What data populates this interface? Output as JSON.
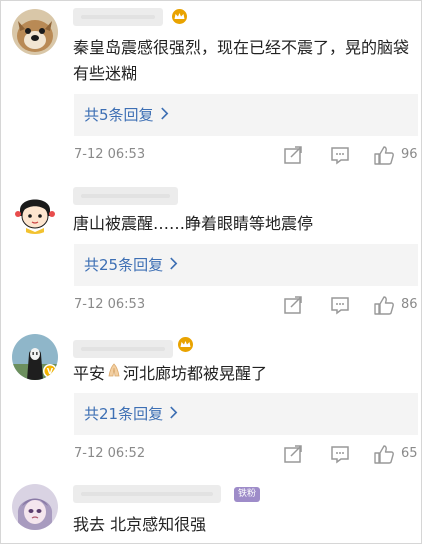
{
  "comments": [
    {
      "text": "秦皇岛震感很强烈，现在已经不震了，晃的脑袋有些迷糊",
      "reply_link": "共5条回复",
      "time": "7-12 06:53",
      "likes": "96"
    },
    {
      "text": "唐山被震醒……睁着眼睛等地震停",
      "reply_link": "共25条回复",
      "time": "7-12 06:53",
      "likes": "86"
    },
    {
      "text_before": "平安",
      "text_after": "河北廊坊都被晃醒了",
      "reply_link": "共21条回复",
      "time": "7-12 06:52",
      "likes": "65"
    },
    {
      "text": "我去 北京感知很强",
      "fan_badge": "铁粉"
    }
  ],
  "icons": {
    "reply_chevron": "chevron-right-icon",
    "share": "share-icon",
    "comment": "comment-icon",
    "like": "thumb-up-icon",
    "crown": "crown-badge-icon",
    "pray": "pray-emoji-icon"
  },
  "colors": {
    "link": "#3d6fb4",
    "meta": "#8a8a8a",
    "reply_bg": "#f4f4f4",
    "crown": "#e9a300"
  }
}
